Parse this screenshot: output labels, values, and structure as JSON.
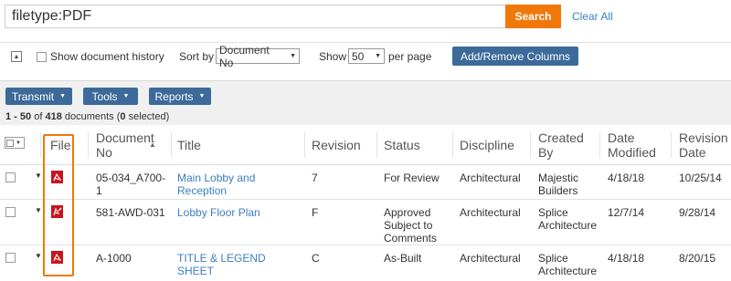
{
  "search": {
    "query": "filetype:PDF",
    "button_label": "Search",
    "clear_label": "Clear All"
  },
  "options": {
    "collapse_icon": "collapse-icon",
    "show_history_label": "Show document history",
    "sort_by_label": "Sort by",
    "sort_by_value": "Document No",
    "show_label": "Show",
    "show_value": "50",
    "per_page_label": "per page",
    "columns_button_label": "Add/Remove Columns"
  },
  "actions": {
    "transmit_label": "Transmit",
    "tools_label": "Tools",
    "reports_label": "Reports",
    "accent_color": "#3c6a9a"
  },
  "summary": {
    "range": "1 - 50",
    "of_text": "of",
    "total": "418",
    "documents_text": "documents",
    "selected_count": "0",
    "selected_text": "selected"
  },
  "table": {
    "headers": {
      "file": "File",
      "document_no": "Document No",
      "title": "Title",
      "revision": "Revision",
      "status": "Status",
      "discipline": "Discipline",
      "created_by": "Created By",
      "date_modified": "Date Modified",
      "revision_date": "Revision Date"
    },
    "rows": [
      {
        "file_icon": "pdf-icon",
        "document_no": "05-034_A700-1",
        "title": "Main Lobby and Reception",
        "revision": "7",
        "status": "For Review",
        "discipline": "Architectural",
        "created_by": "Majestic Builders",
        "date_modified": "4/18/18",
        "revision_date": "10/25/14"
      },
      {
        "file_icon": "pdf-edit-icon",
        "document_no": "581-AWD-031",
        "title": "Lobby Floor Plan",
        "revision": "F",
        "status": "Approved Subject to Comments",
        "discipline": "Architectural",
        "created_by": "Splice Architecture",
        "date_modified": "12/7/14",
        "revision_date": "9/28/14"
      },
      {
        "file_icon": "pdf-icon",
        "document_no": "A-1000",
        "title": "TITLE & LEGEND SHEET",
        "revision": "C",
        "status": "As-Built",
        "discipline": "Architectural",
        "created_by": "Splice Architecture",
        "date_modified": "4/18/18",
        "revision_date": "8/20/15"
      }
    ]
  },
  "colors": {
    "search_button": "#f0780a",
    "link": "#3a7fc1",
    "pdf_icon": "#c8141e",
    "highlight": "#f0780a"
  }
}
